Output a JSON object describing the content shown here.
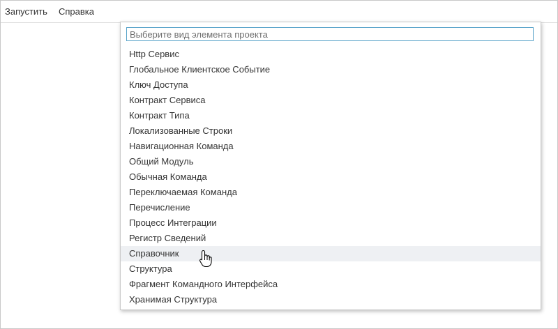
{
  "menubar": {
    "run_label": "Запустить",
    "help_label": "Справка"
  },
  "dropdown": {
    "search_placeholder": "Выберите вид элемента проекта",
    "search_value": "",
    "items": [
      "Http Сервис",
      "Глобальное Клиентское Событие",
      "Ключ Доступа",
      "Контракт Сервиса",
      "Контракт Типа",
      "Локализованные Строки",
      "Навигационная Команда",
      "Общий Модуль",
      "Обычная Команда",
      "Переключаемая Команда",
      "Перечисление",
      "Процесс Интеграции",
      "Регистр Сведений",
      "Справочник",
      "Структура",
      "Фрагмент Командного Интерфейса",
      "Хранимая Структура"
    ],
    "hovered_item": "Справочник"
  },
  "cursor": {
    "icon": "hand-pointer-icon"
  }
}
